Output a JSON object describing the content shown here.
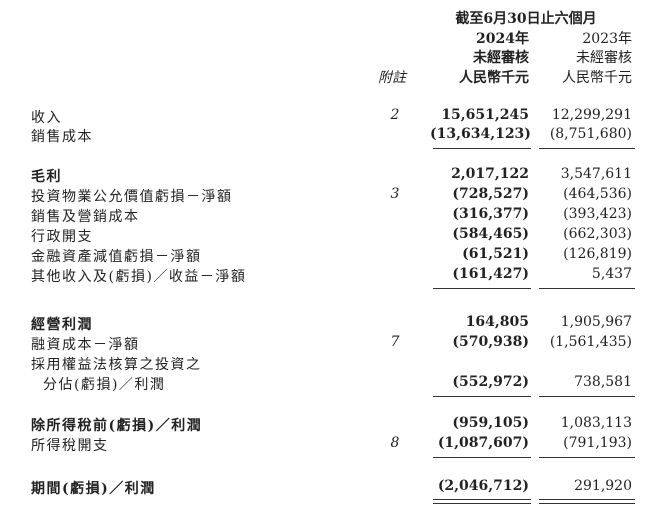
{
  "header": {
    "period": "截至6月30日止六個月",
    "year_2024": "2024年",
    "year_2023": "2023年",
    "audit_2024": "未經審核",
    "audit_2023": "未經審核",
    "note_label": "附註",
    "unit_2024": "人民幣千元",
    "unit_2023": "人民幣千元"
  },
  "rows": [
    {
      "label": "收入",
      "note": "2",
      "v2024": "15,651,245",
      "v2023": "12,299,291"
    },
    {
      "label": "銷售成本",
      "note": "",
      "v2024": "(13,634,123)",
      "v2023": "(8,751,680)"
    },
    {
      "label": "毛利",
      "note": "",
      "v2024": "2,017,122",
      "v2023": "3,547,611"
    },
    {
      "label": "投資物業公允價值虧損－淨額",
      "note": "3",
      "v2024": "(728,527)",
      "v2023": "(464,536)"
    },
    {
      "label": "銷售及營銷成本",
      "note": "",
      "v2024": "(316,377)",
      "v2023": "(393,423)"
    },
    {
      "label": "行政開支",
      "note": "",
      "v2024": "(584,465)",
      "v2023": "(662,303)"
    },
    {
      "label": "金融資產減值虧損－淨額",
      "note": "",
      "v2024": "(61,521)",
      "v2023": "(126,819)"
    },
    {
      "label": "其他收入及(虧損)／收益－淨額",
      "note": "",
      "v2024": "(161,427)",
      "v2023": "5,437"
    },
    {
      "label": "經營利潤",
      "note": "",
      "v2024": "164,805",
      "v2023": "1,905,967"
    },
    {
      "label": "融資成本－淨額",
      "note": "7",
      "v2024": "(570,938)",
      "v2023": "(1,561,435)"
    },
    {
      "label": "採用權益法核算之投資之",
      "note": "",
      "v2024": "",
      "v2023": ""
    },
    {
      "label": "分佔(虧損)／利潤",
      "note": "",
      "v2024": "(552,972)",
      "v2023": "738,581"
    },
    {
      "label": "除所得稅前(虧損)／利潤",
      "note": "",
      "v2024": "(959,105)",
      "v2023": "1,083,113"
    },
    {
      "label": "所得稅開支",
      "note": "8",
      "v2024": "(1,087,607)",
      "v2023": "(791,193)"
    },
    {
      "label": "期間(虧損)／利潤",
      "note": "",
      "v2024": "(2,046,712)",
      "v2023": "291,920"
    }
  ]
}
